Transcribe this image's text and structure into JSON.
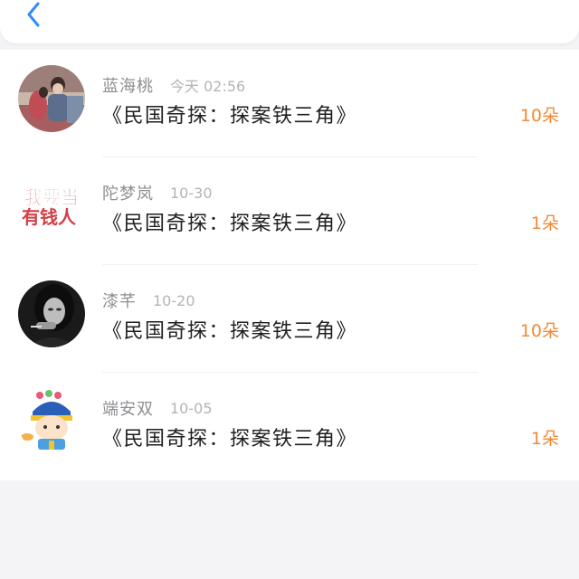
{
  "header": {
    "back_icon": "chevron-left-icon",
    "accent": "#2f8ef5"
  },
  "gifts": [
    {
      "name": "蓝海桃",
      "time": "今天 02:56",
      "title": "《民国奇探：探案铁三角》",
      "amount": "10朵"
    },
    {
      "name": "陀梦岚",
      "time": "10-30",
      "title": "《民国奇探：探案铁三角》",
      "amount": "1朵",
      "avatar_text_1": "我要当",
      "avatar_text_2": "有钱人"
    },
    {
      "name": "漆芊",
      "time": "10-20",
      "title": "《民国奇探：探案铁三角》",
      "amount": "10朵"
    },
    {
      "name": "端安双",
      "time": "10-05",
      "title": "《民国奇探：探案铁三角》",
      "amount": "1朵"
    }
  ],
  "colors": {
    "amount": "#f08a36",
    "name": "#8e8e93",
    "time": "#b4b4b8",
    "title": "#1f1f1f",
    "background": "#f4f3f6"
  }
}
